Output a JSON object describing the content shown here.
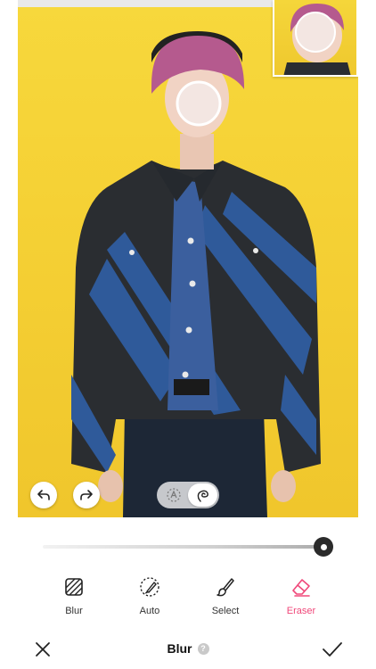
{
  "canvas": {
    "background": "#f5d135"
  },
  "tools": {
    "items": [
      {
        "label": "Blur",
        "icon": "blur-fill-icon"
      },
      {
        "label": "Auto",
        "icon": "auto-brush-icon"
      },
      {
        "label": "Select",
        "icon": "brush-icon"
      },
      {
        "label": "Eraser",
        "icon": "eraser-icon"
      }
    ],
    "active": "Eraser",
    "accent_color": "#f0487a"
  },
  "slider": {
    "value": 1.0
  },
  "mode_toggle": {
    "options": [
      "auto-select-icon",
      "lasso-icon"
    ],
    "active": "lasso-icon"
  },
  "bottom_bar": {
    "title": "Blur",
    "help_label": "?"
  }
}
